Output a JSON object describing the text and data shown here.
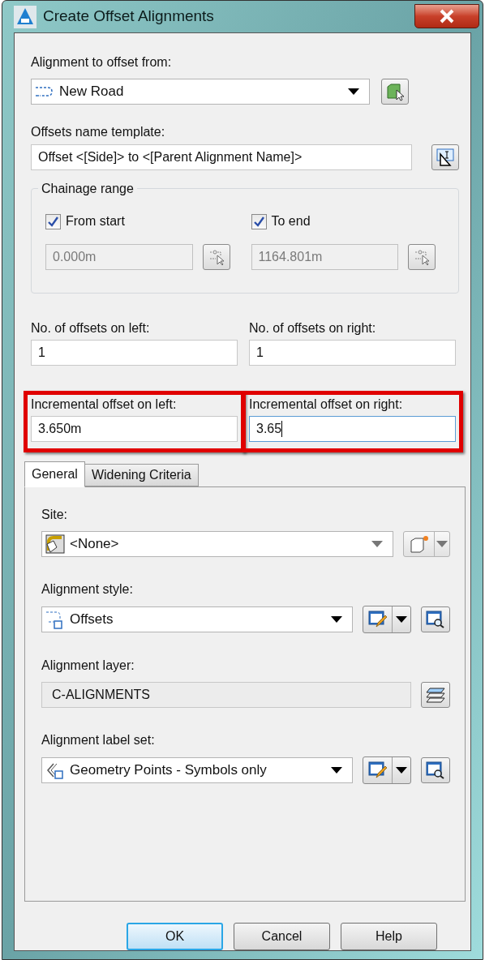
{
  "window": {
    "title": "Create Offset Alignments"
  },
  "alignment": {
    "label": "Alignment to offset from:",
    "value": "New Road"
  },
  "name_template": {
    "label": "Offsets name template:",
    "value": "Offset <[Side]> to <[Parent Alignment Name]>"
  },
  "chainage_range": {
    "title": "Chainage range",
    "ends": [
      {
        "label": "From start",
        "checked": true,
        "value": "0.000m",
        "disabled": true
      },
      {
        "label": "To end",
        "checked": true,
        "value": "1164.801m",
        "disabled": true
      }
    ]
  },
  "offset_fields": [
    {
      "label": "No. of offsets on left:",
      "value": "1",
      "highlighted": false,
      "focused": false
    },
    {
      "label": "No. of offsets on right:",
      "value": "1",
      "highlighted": false,
      "focused": false
    },
    {
      "label": "Incremental offset on left:",
      "value": "3.650m",
      "highlighted": true,
      "focused": false
    },
    {
      "label": "Incremental offset on right:",
      "value": "3.65",
      "highlighted": true,
      "focused": true
    }
  ],
  "tabs": [
    {
      "label": "General",
      "selected": true
    },
    {
      "label": "Widening Criteria",
      "selected": false
    }
  ],
  "general": [
    {
      "kind": "site",
      "label": "Site:",
      "value": "<None>"
    },
    {
      "kind": "style",
      "label": "Alignment style:",
      "value": "Offsets"
    },
    {
      "kind": "layer",
      "label": "Alignment layer:",
      "value": "C-ALIGNMENTS"
    },
    {
      "kind": "labelset",
      "label": "Alignment label set:",
      "value": "Geometry Points -  Symbols only"
    }
  ],
  "buttons": [
    {
      "label": "OK",
      "default": true
    },
    {
      "label": "Cancel",
      "default": false
    },
    {
      "label": "Help",
      "default": false
    }
  ]
}
